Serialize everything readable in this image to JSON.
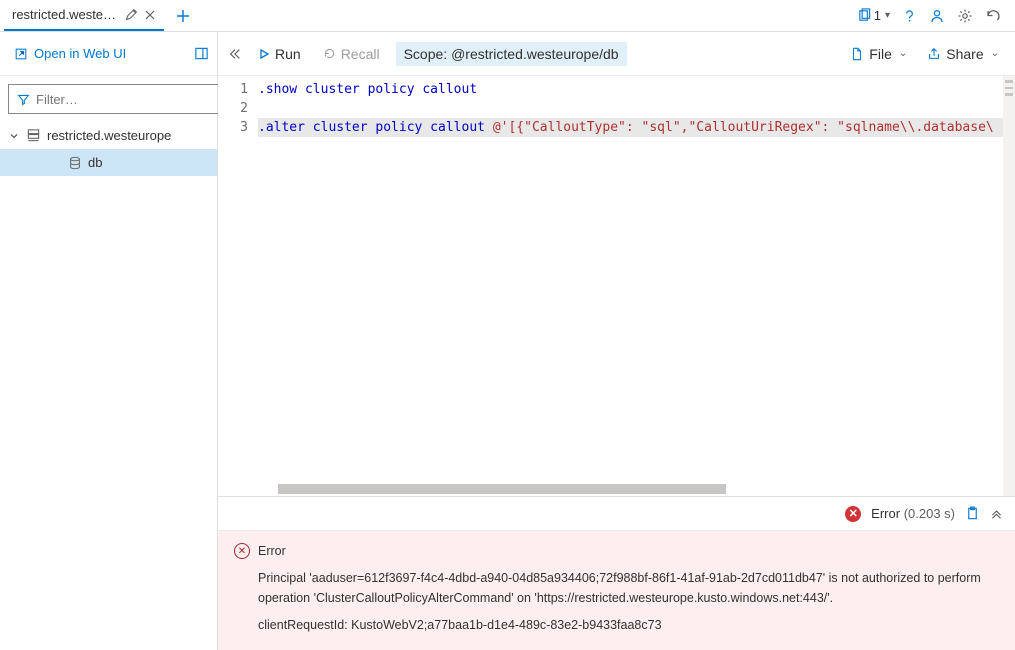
{
  "tab": {
    "title": "restricted.westeur…",
    "edit_icon": "pencil-icon",
    "close_icon": "close-icon",
    "add_icon": "plus-icon"
  },
  "tabbar_right": {
    "copy_count": "1",
    "help_icon": "help-icon",
    "feedback_icon": "feedback-icon",
    "settings_icon": "gear-icon",
    "undo_icon": "undo-icon"
  },
  "sidebar": {
    "open_web_label": "Open in Web UI",
    "panel_icon": "panel-icon",
    "filter_placeholder": "Filter…",
    "pin_icon": "star-icon",
    "cluster_label": "restricted.westeurope",
    "db_label": "db"
  },
  "toolbar": {
    "collapse_icon": "chevrons-left-icon",
    "run_label": "Run",
    "recall_label": "Recall",
    "scope_label": "Scope:",
    "scope_value": "@restricted.westeurope/db",
    "file_label": "File",
    "share_label": "Share"
  },
  "editor": {
    "lines": [
      {
        "n": "1",
        "tokens": [
          {
            "t": ".show cluster policy callout",
            "c": "kw"
          }
        ]
      },
      {
        "n": "2",
        "tokens": []
      },
      {
        "n": "3",
        "hl": true,
        "tokens": [
          {
            "t": ".alter cluster policy callout ",
            "c": "kw"
          },
          {
            "t": "@'[{\"CalloutType\": \"sql\",\"CalloutUriRegex\": \"sqlname\\\\.database\\",
            "c": "str"
          }
        ]
      }
    ]
  },
  "results": {
    "status_label": "Error",
    "timing": "(0.203 s)",
    "clipboard_icon": "clipboard-icon",
    "expand_icon": "chevrons-up-icon",
    "error_title": "Error",
    "error_message": "Principal 'aaduser=612f3697-f4c4-4dbd-a940-04d85a934406;72f988bf-86f1-41af-91ab-2d7cd011db47' is not authorized to perform operation 'ClusterCalloutPolicyAlterCommand' on 'https://restricted.westeurope.kusto.windows.net:443/'.",
    "client_request": "clientRequestId: KustoWebV2;a77baa1b-d1e4-489c-83e2-b9433faa8c73"
  }
}
